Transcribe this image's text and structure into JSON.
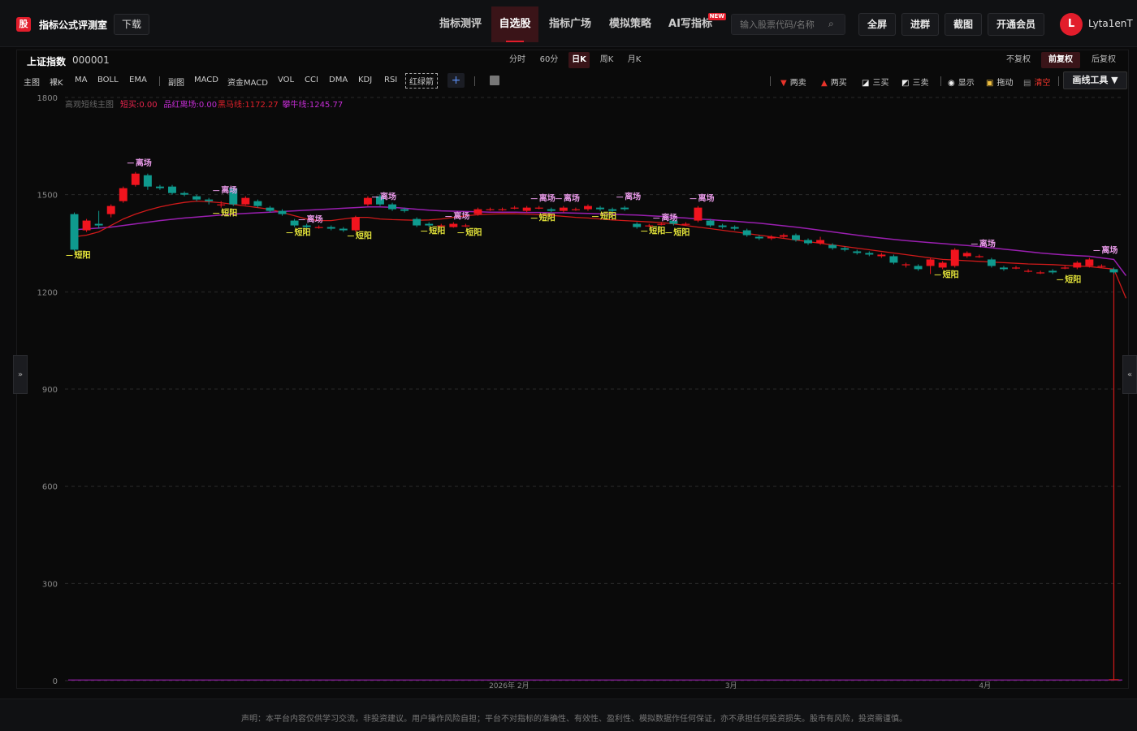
{
  "header": {
    "logo_char": "股",
    "site_name": "指标公式评测室",
    "download_label": "下载",
    "nav": [
      "指标测评",
      "自选股",
      "指标广场",
      "模拟策略",
      "AI写指标"
    ],
    "nav_active": 1,
    "new_badge": "NEW",
    "search_placeholder": "输入股票代码/名称",
    "buttons": [
      "全屏",
      "进群",
      "截图",
      "开通会员"
    ],
    "avatar_letter": "L",
    "username": "Lyta1enT"
  },
  "stock": {
    "name": "上证指数",
    "code": "000001"
  },
  "periods": [
    "分时",
    "60分",
    "日K",
    "周K",
    "月K"
  ],
  "period_active": "日K",
  "adjust_options": [
    "不复权",
    "前复权",
    "后复权"
  ],
  "adjust_active": "前复权",
  "indicators": [
    "主图",
    "裸K",
    "MA",
    "BOLL",
    "EMA",
    "副图",
    "MACD",
    "资金MACD",
    "VOL",
    "CCI",
    "DMA",
    "KDJ",
    "RSI",
    "红绿箭"
  ],
  "tools": [
    "两卖",
    "两买",
    "三买",
    "三卖",
    "显示",
    "拖动",
    "清空"
  ],
  "draw_tool_label": "画线工具 ▼",
  "side_left": "»",
  "side_right": "«",
  "legend": {
    "name": "高观短线主图",
    "items": [
      {
        "text": "短买:0.00",
        "color": "#e8244d"
      },
      {
        "text": "品红离场:0.00",
        "color": "#c42dd4"
      },
      {
        "text": "黑马线:1172.27",
        "color": "#e0202a"
      },
      {
        "text": "攀牛线:1245.77",
        "color": "#c42dd4"
      }
    ]
  },
  "chart_data": {
    "type": "candlestick",
    "y_ticks": [
      1800,
      1500,
      1200,
      900,
      600,
      300,
      0
    ],
    "ylim": [
      0,
      1800
    ],
    "x_tick_labels": [
      "2026年 2月",
      "3月",
      "4月"
    ],
    "colors": {
      "up": "#f0141e",
      "down": "#0f9a8e",
      "ma_red": "#d01a1a",
      "ma_purple": "#9a1fb0",
      "buy": "#e6e63a",
      "sell": "#e89ae8"
    },
    "candles": [
      [
        1440,
        1330,
        1445,
        1325
      ],
      [
        1390,
        1420,
        1425,
        1385
      ],
      [
        1410,
        1405,
        1450,
        1395
      ],
      [
        1440,
        1465,
        1470,
        1430
      ],
      [
        1480,
        1520,
        1525,
        1475
      ],
      [
        1530,
        1565,
        1570,
        1525
      ],
      [
        1560,
        1525,
        1565,
        1515
      ],
      [
        1525,
        1520,
        1530,
        1515
      ],
      [
        1525,
        1505,
        1530,
        1500
      ],
      [
        1505,
        1500,
        1510,
        1495
      ],
      [
        1495,
        1485,
        1500,
        1480
      ],
      [
        1485,
        1480,
        1490,
        1470
      ],
      [
        1470,
        1470,
        1480,
        1460
      ],
      [
        1520,
        1470,
        1525,
        1465
      ],
      [
        1470,
        1490,
        1495,
        1468
      ],
      [
        1480,
        1465,
        1485,
        1460
      ],
      [
        1460,
        1450,
        1465,
        1445
      ],
      [
        1450,
        1440,
        1455,
        1435
      ],
      [
        1420,
        1405,
        1425,
        1400
      ],
      [
        1405,
        1400,
        1410,
        1395
      ],
      [
        1400,
        1400,
        1405,
        1395
      ],
      [
        1400,
        1395,
        1405,
        1390
      ],
      [
        1395,
        1390,
        1400,
        1385
      ],
      [
        1390,
        1430,
        1435,
        1385
      ],
      [
        1470,
        1490,
        1495,
        1465
      ],
      [
        1495,
        1470,
        1500,
        1465
      ],
      [
        1470,
        1455,
        1475,
        1450
      ],
      [
        1455,
        1450,
        1460,
        1445
      ],
      [
        1425,
        1405,
        1430,
        1400
      ],
      [
        1410,
        1405,
        1415,
        1400
      ],
      [
        1405,
        1405,
        1410,
        1400
      ],
      [
        1400,
        1410,
        1415,
        1398
      ],
      [
        1405,
        1405,
        1410,
        1400
      ],
      [
        1440,
        1455,
        1460,
        1435
      ],
      [
        1455,
        1455,
        1460,
        1450
      ],
      [
        1455,
        1455,
        1460,
        1450
      ],
      [
        1460,
        1460,
        1465,
        1455
      ],
      [
        1450,
        1460,
        1465,
        1445
      ],
      [
        1460,
        1460,
        1465,
        1455
      ],
      [
        1455,
        1450,
        1460,
        1445
      ],
      [
        1450,
        1460,
        1465,
        1445
      ],
      [
        1455,
        1455,
        1460,
        1450
      ],
      [
        1455,
        1465,
        1470,
        1450
      ],
      [
        1460,
        1455,
        1465,
        1450
      ],
      [
        1455,
        1450,
        1460,
        1445
      ],
      [
        1460,
        1455,
        1465,
        1450
      ],
      [
        1410,
        1400,
        1415,
        1395
      ],
      [
        1405,
        1405,
        1410,
        1400
      ],
      [
        1410,
        1410,
        1415,
        1405
      ],
      [
        1420,
        1410,
        1425,
        1405
      ],
      [
        1410,
        1410,
        1415,
        1405
      ],
      [
        1420,
        1460,
        1465,
        1415
      ],
      [
        1420,
        1405,
        1425,
        1400
      ],
      [
        1405,
        1400,
        1410,
        1395
      ],
      [
        1400,
        1395,
        1405,
        1390
      ],
      [
        1390,
        1375,
        1395,
        1370
      ],
      [
        1370,
        1365,
        1375,
        1360
      ],
      [
        1365,
        1370,
        1375,
        1360
      ],
      [
        1370,
        1375,
        1380,
        1365
      ],
      [
        1375,
        1360,
        1380,
        1355
      ],
      [
        1360,
        1350,
        1365,
        1345
      ],
      [
        1350,
        1360,
        1370,
        1345
      ],
      [
        1345,
        1335,
        1350,
        1330
      ],
      [
        1335,
        1330,
        1340,
        1325
      ],
      [
        1325,
        1320,
        1330,
        1315
      ],
      [
        1320,
        1315,
        1325,
        1310
      ],
      [
        1310,
        1315,
        1320,
        1305
      ],
      [
        1310,
        1290,
        1315,
        1285
      ],
      [
        1285,
        1285,
        1290,
        1275
      ],
      [
        1280,
        1270,
        1285,
        1265
      ],
      [
        1280,
        1300,
        1305,
        1255
      ],
      [
        1275,
        1290,
        1295,
        1270
      ],
      [
        1280,
        1330,
        1335,
        1275
      ],
      [
        1310,
        1320,
        1325,
        1305
      ],
      [
        1310,
        1310,
        1315,
        1305
      ],
      [
        1300,
        1280,
        1305,
        1275
      ],
      [
        1275,
        1270,
        1280,
        1265
      ],
      [
        1275,
        1275,
        1280,
        1270
      ],
      [
        1265,
        1265,
        1270,
        1260
      ],
      [
        1260,
        1260,
        1265,
        1255
      ],
      [
        1265,
        1260,
        1270,
        1255
      ],
      [
        1275,
        1275,
        1280,
        1270
      ],
      [
        1275,
        1290,
        1295,
        1270
      ],
      [
        1280,
        1300,
        1305,
        1275
      ],
      [
        1280,
        1280,
        1285,
        1275
      ],
      [
        1270,
        1260,
        1275,
        1255
      ]
    ],
    "ma_red": [
      1370,
      1375,
      1385,
      1405,
      1425,
      1440,
      1452,
      1462,
      1470,
      1476,
      1480,
      1478,
      1475,
      1470,
      1465,
      1460,
      1455,
      1445,
      1435,
      1425,
      1420,
      1420,
      1425,
      1430,
      1430,
      1425,
      1423,
      1422,
      1421,
      1422,
      1425,
      1430,
      1435,
      1438,
      1440,
      1441,
      1441,
      1440,
      1438,
      1436,
      1433,
      1430,
      1428,
      1425,
      1422,
      1420,
      1418,
      1416,
      1414,
      1410,
      1405,
      1400,
      1395,
      1390,
      1385,
      1380,
      1375,
      1370,
      1365,
      1360,
      1355,
      1350,
      1345,
      1340,
      1335,
      1330,
      1325,
      1320,
      1315,
      1310,
      1305,
      1300,
      1298,
      1296,
      1294,
      1292,
      1290,
      1288,
      1286,
      1285,
      1284,
      1282,
      1280,
      1278,
      1274,
      1270,
      1180
    ],
    "ma_purple": [
      1392,
      1394,
      1397,
      1400,
      1405,
      1410,
      1415,
      1420,
      1424,
      1428,
      1431,
      1434,
      1437,
      1440,
      1442,
      1444,
      1446,
      1448,
      1450,
      1452,
      1454,
      1456,
      1458,
      1460,
      1462,
      1462,
      1461,
      1458,
      1455,
      1452,
      1450,
      1449,
      1448,
      1447,
      1446,
      1446,
      1446,
      1445,
      1445,
      1444,
      1444,
      1443,
      1442,
      1441,
      1440,
      1438,
      1437,
      1435,
      1433,
      1430,
      1428,
      1425,
      1423,
      1420,
      1418,
      1415,
      1412,
      1408,
      1404,
      1400,
      1395,
      1390,
      1385,
      1380,
      1375,
      1370,
      1366,
      1362,
      1358,
      1355,
      1352,
      1349,
      1346,
      1343,
      1340,
      1336,
      1332,
      1328,
      1324,
      1320,
      1317,
      1314,
      1312,
      1310,
      1305,
      1300,
      1250
    ],
    "signals": [
      {
        "i": 0,
        "label": "短阳",
        "kind": "buy",
        "price": 1325
      },
      {
        "i": 5,
        "label": "离场",
        "kind": "sell",
        "price": 1575
      },
      {
        "i": 12,
        "label": "离场",
        "kind": "sell",
        "price": 1490
      },
      {
        "i": 12,
        "label": "短阳",
        "kind": "buy",
        "price": 1455
      },
      {
        "i": 18,
        "label": "短阳",
        "kind": "buy",
        "price": 1395
      },
      {
        "i": 19,
        "label": "离场",
        "kind": "sell",
        "price": 1400
      },
      {
        "i": 23,
        "label": "短阳",
        "kind": "buy",
        "price": 1385
      },
      {
        "i": 25,
        "label": "离场",
        "kind": "sell",
        "price": 1470
      },
      {
        "i": 29,
        "label": "短阳",
        "kind": "buy",
        "price": 1400
      },
      {
        "i": 31,
        "label": "离场",
        "kind": "sell",
        "price": 1410
      },
      {
        "i": 32,
        "label": "短阳",
        "kind": "buy",
        "price": 1395
      },
      {
        "i": 38,
        "label": "离场",
        "kind": "sell",
        "price": 1465
      },
      {
        "i": 38,
        "label": "短阳",
        "kind": "buy",
        "price": 1440
      },
      {
        "i": 40,
        "label": "离场",
        "kind": "sell",
        "price": 1465
      },
      {
        "i": 43,
        "label": "短阳",
        "kind": "buy",
        "price": 1445
      },
      {
        "i": 45,
        "label": "离场",
        "kind": "sell",
        "price": 1470
      },
      {
        "i": 47,
        "label": "短阳",
        "kind": "buy",
        "price": 1400
      },
      {
        "i": 48,
        "label": "离场",
        "kind": "sell",
        "price": 1405
      },
      {
        "i": 49,
        "label": "短阳",
        "kind": "buy",
        "price": 1395
      },
      {
        "i": 51,
        "label": "离场",
        "kind": "sell",
        "price": 1465
      },
      {
        "i": 71,
        "label": "短阳",
        "kind": "buy",
        "price": 1265
      },
      {
        "i": 74,
        "label": "离场",
        "kind": "sell",
        "price": 1325
      },
      {
        "i": 81,
        "label": "短阳",
        "kind": "buy",
        "price": 1250
      },
      {
        "i": 84,
        "label": "离场",
        "kind": "sell",
        "price": 1305
      }
    ]
  },
  "footer": {
    "disclaimer": "声明：本平台内容仅供学习交流，非投资建议。用户操作风险自担；平台不对指标的准确性、有效性、盈利性、模拟数据作任何保证，亦不承担任何投资损失。股市有风险，投资需谨慎。"
  }
}
